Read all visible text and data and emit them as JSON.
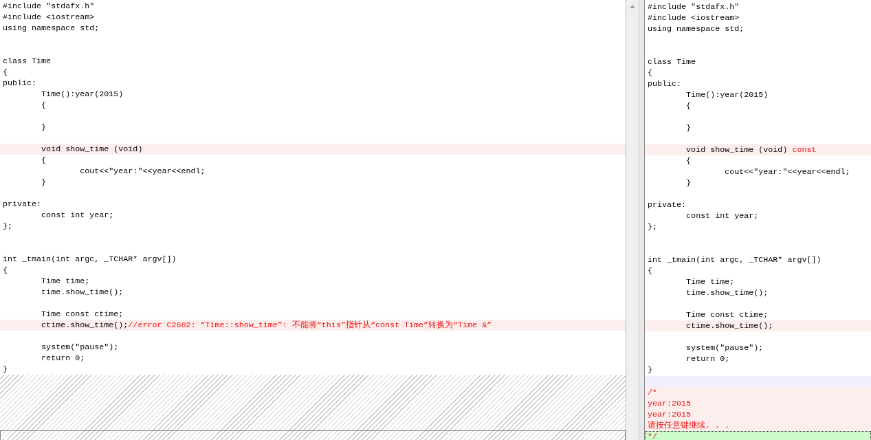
{
  "left_pane": {
    "lines": [
      {
        "changed": false,
        "segments": [
          {
            "text": "#include \"stdafx.h\"",
            "diff": false
          }
        ]
      },
      {
        "changed": false,
        "segments": [
          {
            "text": "#include <iostream>",
            "diff": false
          }
        ]
      },
      {
        "changed": false,
        "segments": [
          {
            "text": "using namespace std;",
            "diff": false
          }
        ]
      },
      {
        "changed": false
      },
      {
        "changed": false
      },
      {
        "changed": false,
        "segments": [
          {
            "text": "class Time",
            "diff": false
          }
        ]
      },
      {
        "changed": false,
        "segments": [
          {
            "text": "{",
            "diff": false
          }
        ]
      },
      {
        "changed": false,
        "segments": [
          {
            "text": "public:",
            "diff": false
          }
        ]
      },
      {
        "changed": false,
        "segments": [
          {
            "text": "\tTime():year(2015)",
            "diff": false
          }
        ]
      },
      {
        "changed": false,
        "segments": [
          {
            "text": "\t{",
            "diff": false
          }
        ]
      },
      {
        "changed": false
      },
      {
        "changed": false,
        "segments": [
          {
            "text": "\t}",
            "diff": false
          }
        ]
      },
      {
        "changed": false
      },
      {
        "changed": true,
        "segments": [
          {
            "text": "\tvoid show_time (void)",
            "diff": false
          }
        ]
      },
      {
        "changed": false,
        "segments": [
          {
            "text": "\t{",
            "diff": false
          }
        ]
      },
      {
        "changed": false,
        "segments": [
          {
            "text": "\t\tcout<<\"year:\"<<year<<endl;",
            "diff": false
          }
        ]
      },
      {
        "changed": false,
        "segments": [
          {
            "text": "\t}",
            "diff": false
          }
        ]
      },
      {
        "changed": false
      },
      {
        "changed": false,
        "segments": [
          {
            "text": "private:",
            "diff": false
          }
        ]
      },
      {
        "changed": false,
        "segments": [
          {
            "text": "\tconst int year;",
            "diff": false
          }
        ]
      },
      {
        "changed": false,
        "segments": [
          {
            "text": "};",
            "diff": false
          }
        ]
      },
      {
        "changed": false
      },
      {
        "changed": false
      },
      {
        "changed": false,
        "segments": [
          {
            "text": "int _tmain(int argc, _TCHAR* argv[])",
            "diff": false
          }
        ]
      },
      {
        "changed": false,
        "segments": [
          {
            "text": "{",
            "diff": false
          }
        ]
      },
      {
        "changed": false,
        "segments": [
          {
            "text": "\tTime time;",
            "diff": false
          }
        ]
      },
      {
        "changed": false,
        "segments": [
          {
            "text": "\ttime.show_time();",
            "diff": false
          }
        ]
      },
      {
        "changed": false
      },
      {
        "changed": false,
        "segments": [
          {
            "text": "\tTime const ctime;",
            "diff": false
          }
        ]
      },
      {
        "changed": true,
        "segments": [
          {
            "text": "\tctime.show_time();",
            "diff": false
          },
          {
            "text": "//error C2662: “Time::show_time”: 不能将“this”指针从“const Time”转换为“Time &”",
            "diff": true
          }
        ]
      },
      {
        "changed": false
      },
      {
        "changed": false,
        "segments": [
          {
            "text": "\tsystem(\"pause\");",
            "diff": false
          }
        ]
      },
      {
        "changed": false,
        "segments": [
          {
            "text": "\treturn 0;",
            "diff": false
          }
        ]
      },
      {
        "changed": false,
        "segments": [
          {
            "text": "}",
            "diff": false
          }
        ]
      }
    ]
  },
  "right_pane": {
    "lines": [
      {
        "changed": false,
        "segments": [
          {
            "text": "#include \"stdafx.h\"",
            "diff": false
          }
        ]
      },
      {
        "changed": false,
        "segments": [
          {
            "text": "#include <iostream>",
            "diff": false
          }
        ]
      },
      {
        "changed": false,
        "segments": [
          {
            "text": "using namespace std;",
            "diff": false
          }
        ]
      },
      {
        "changed": false
      },
      {
        "changed": false
      },
      {
        "changed": false,
        "segments": [
          {
            "text": "class Time",
            "diff": false
          }
        ]
      },
      {
        "changed": false,
        "segments": [
          {
            "text": "{",
            "diff": false
          }
        ]
      },
      {
        "changed": false,
        "segments": [
          {
            "text": "public:",
            "diff": false
          }
        ]
      },
      {
        "changed": false,
        "segments": [
          {
            "text": "\tTime():year(2015)",
            "diff": false
          }
        ]
      },
      {
        "changed": false,
        "segments": [
          {
            "text": "\t{",
            "diff": false
          }
        ]
      },
      {
        "changed": false
      },
      {
        "changed": false,
        "segments": [
          {
            "text": "\t}",
            "diff": false
          }
        ]
      },
      {
        "changed": false
      },
      {
        "changed": true,
        "segments": [
          {
            "text": "\tvoid show_time (void) ",
            "diff": false
          },
          {
            "text": "const",
            "diff": true
          }
        ]
      },
      {
        "changed": false,
        "segments": [
          {
            "text": "\t{",
            "diff": false
          }
        ]
      },
      {
        "changed": false,
        "segments": [
          {
            "text": "\t\tcout<<\"year:\"<<year<<endl;",
            "diff": false
          }
        ]
      },
      {
        "changed": false,
        "segments": [
          {
            "text": "\t}",
            "diff": false
          }
        ]
      },
      {
        "changed": false
      },
      {
        "changed": false,
        "segments": [
          {
            "text": "private:",
            "diff": false
          }
        ]
      },
      {
        "changed": false,
        "segments": [
          {
            "text": "\tconst int year;",
            "diff": false
          }
        ]
      },
      {
        "changed": false,
        "segments": [
          {
            "text": "};",
            "diff": false
          }
        ]
      },
      {
        "changed": false
      },
      {
        "changed": false
      },
      {
        "changed": false,
        "segments": [
          {
            "text": "int _tmain(int argc, _TCHAR* argv[])",
            "diff": false
          }
        ]
      },
      {
        "changed": false,
        "segments": [
          {
            "text": "{",
            "diff": false
          }
        ]
      },
      {
        "changed": false,
        "segments": [
          {
            "text": "\tTime time;",
            "diff": false
          }
        ]
      },
      {
        "changed": false,
        "segments": [
          {
            "text": "\ttime.show_time();",
            "diff": false
          }
        ]
      },
      {
        "changed": false
      },
      {
        "changed": false,
        "segments": [
          {
            "text": "\tTime const ctime;",
            "diff": false
          }
        ]
      },
      {
        "changed": true,
        "segments": [
          {
            "text": "\tctime.show_time();",
            "diff": false
          }
        ]
      },
      {
        "changed": false
      },
      {
        "changed": false,
        "segments": [
          {
            "text": "\tsystem(\"pause\");",
            "diff": false
          }
        ]
      },
      {
        "changed": false,
        "segments": [
          {
            "text": "\treturn 0;",
            "diff": false
          }
        ]
      },
      {
        "changed": false,
        "segments": [
          {
            "text": "}",
            "diff": false
          }
        ]
      }
    ]
  },
  "output_block": {
    "lines": [
      {
        "kind": "filler"
      },
      {
        "kind": "output",
        "segments": [
          {
            "text": "/*",
            "diff": true
          }
        ]
      },
      {
        "kind": "output",
        "segments": [
          {
            "text": "year:2015",
            "diff": true
          }
        ]
      },
      {
        "kind": "output",
        "segments": [
          {
            "text": "year:2015",
            "diff": true
          }
        ]
      },
      {
        "kind": "output",
        "segments": [
          {
            "text": "请按任意键继续. . .",
            "diff": true
          }
        ]
      },
      {
        "kind": "current",
        "segments": [
          {
            "text": "*/",
            "diff": true
          }
        ]
      }
    ]
  }
}
